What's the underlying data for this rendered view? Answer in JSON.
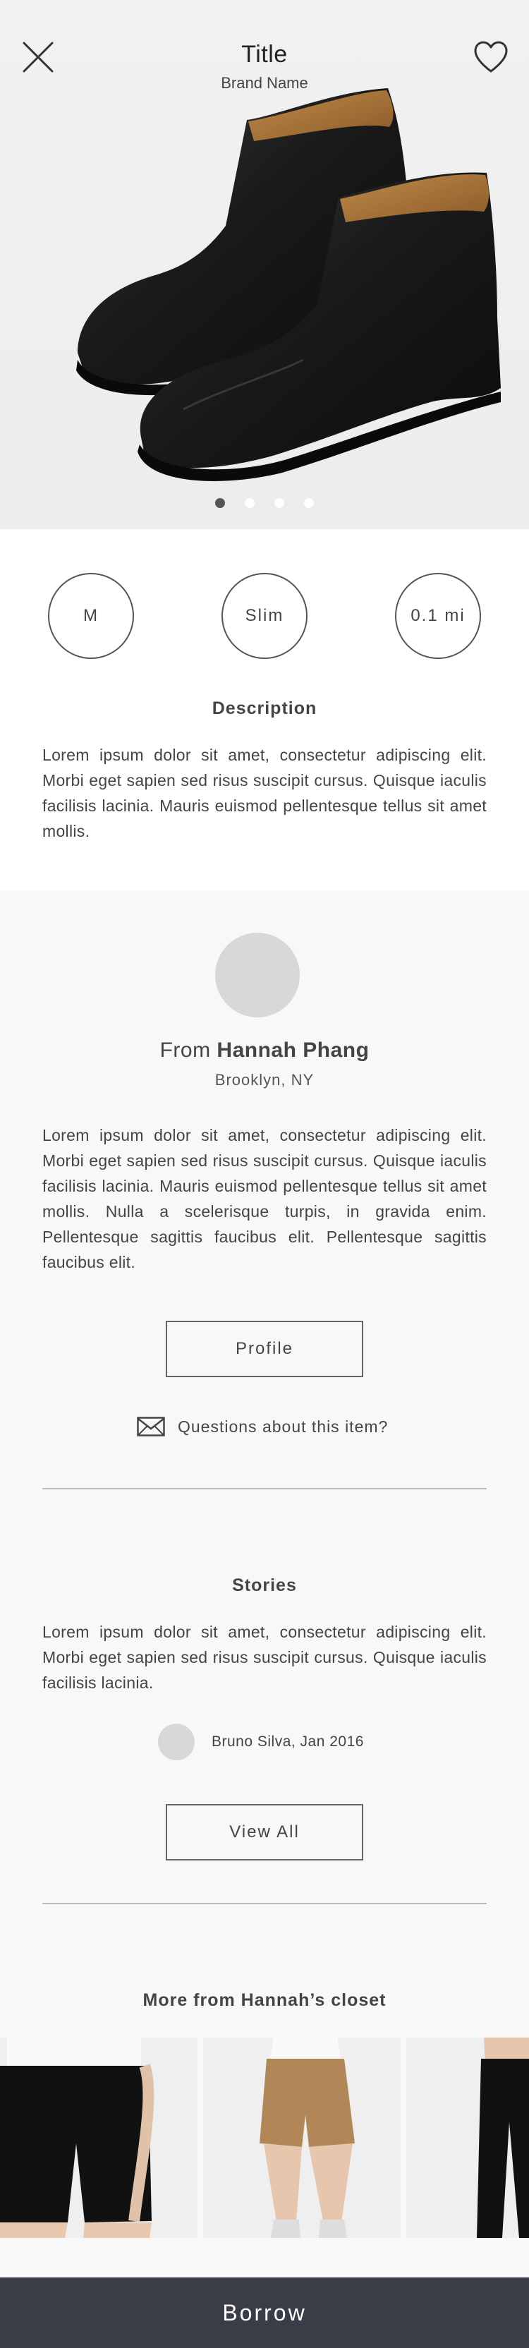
{
  "header": {
    "title": "Title",
    "brand": "Brand Name",
    "close_icon": "close-icon",
    "favorite_icon": "heart-icon"
  },
  "carousel": {
    "image": "black leather ankle boots",
    "page_count": 4,
    "active_index": 0
  },
  "attributes": [
    "M",
    "Slim",
    "0.1 mi"
  ],
  "description": {
    "heading": "Description",
    "text": "Lorem ipsum dolor sit amet, consectetur adipiscing elit. Morbi eget sapien sed risus suscipit cursus. Quisque iaculis facilisis lacinia. Mauris euismod pellentesque tellus sit amet mollis."
  },
  "seller": {
    "from_prefix": "From",
    "name": "Hannah Phang",
    "location": "Brooklyn, NY",
    "bio": "Lorem ipsum dolor sit amet, consectetur adipiscing elit. Morbi eget sapien sed risus suscipit cursus. Quisque iaculis facilisis lacinia. Mauris euismod pellentesque tellus sit amet mollis. Nulla a scelerisque turpis, in gravida enim. Pellentesque sagittis faucibus elit. Pellentesque sagittis faucibus elit.",
    "profile_button": "Profile",
    "question_text": "Questions about this item?",
    "question_icon": "mail-icon"
  },
  "stories": {
    "heading": "Stories",
    "text": "Lorem ipsum dolor sit amet, consectetur adipiscing elit. Morbi eget sapien sed risus suscipit cursus. Quisque iaculis facilisis lacinia.",
    "author": "Bruno Silva, Jan 2016",
    "view_all_button": "View All"
  },
  "closet": {
    "heading": "More from Hannah’s closet",
    "items": [
      "black shorts",
      "tan shorts",
      "black trousers"
    ]
  },
  "borrow_button": "Borrow",
  "colors": {
    "accent_bar": "#3a3c47",
    "avatar_placeholder": "#d8d8d8",
    "page_bg": "#f8f8f8"
  }
}
